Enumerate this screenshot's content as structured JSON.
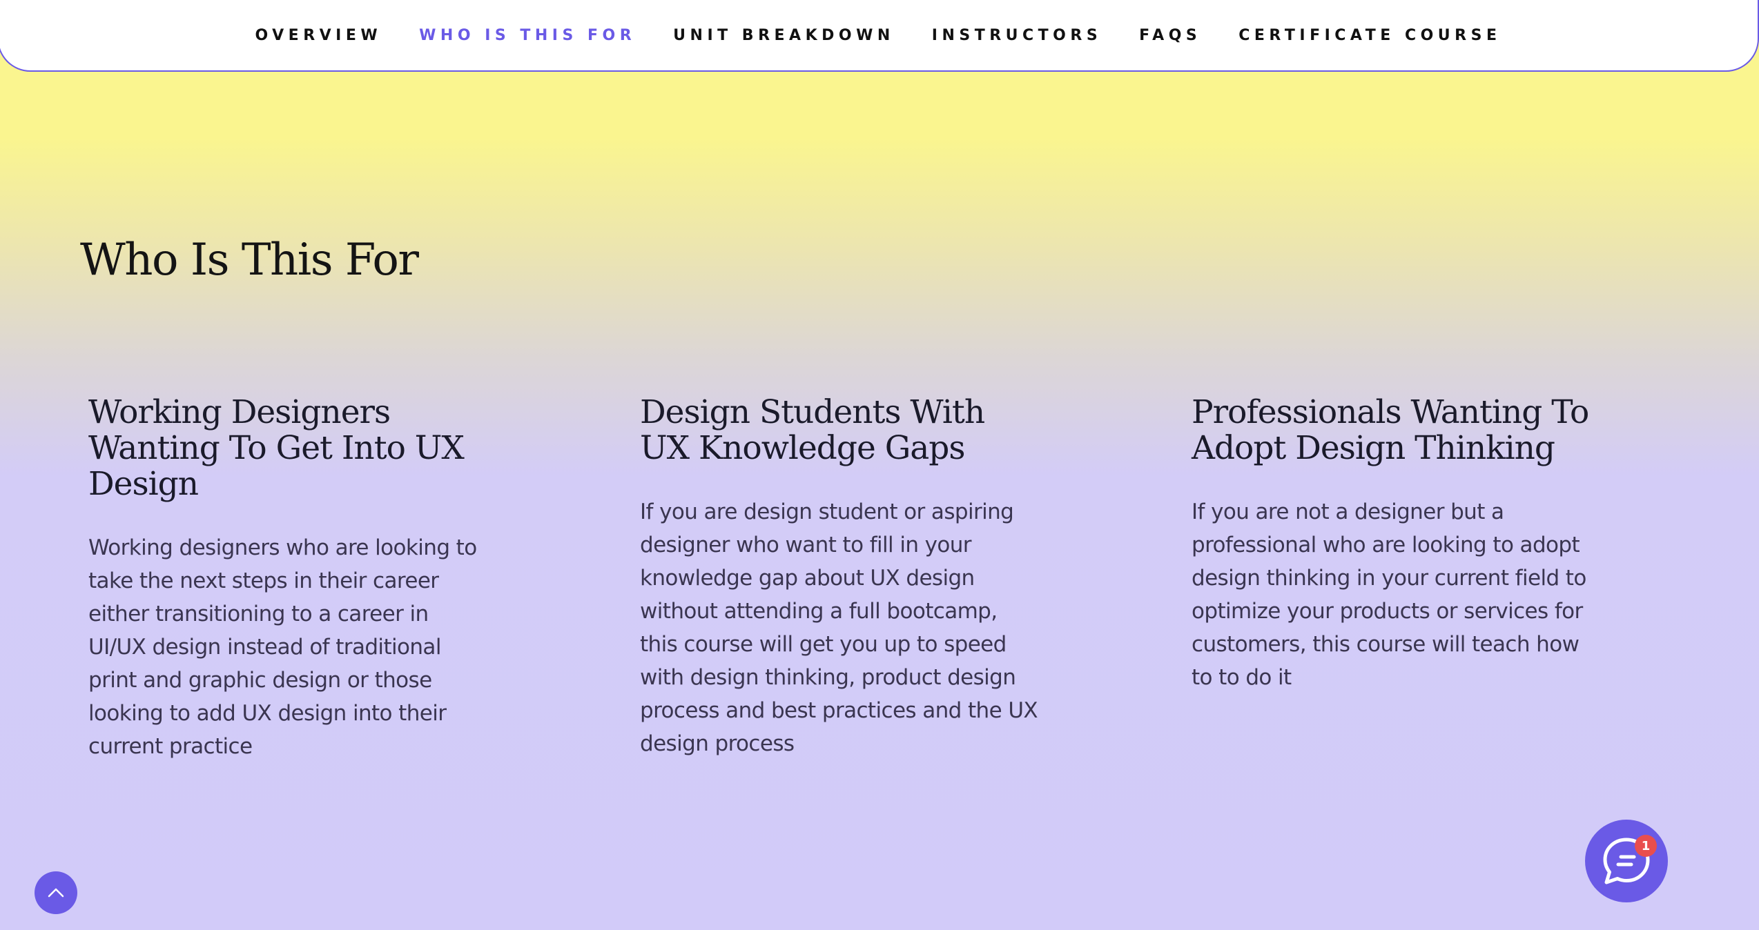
{
  "nav": {
    "items": [
      {
        "label": "OVERVIEW",
        "active": false
      },
      {
        "label": "WHO IS THIS FOR",
        "active": true
      },
      {
        "label": "UNIT BREAKDOWN",
        "active": false
      },
      {
        "label": "INSTRUCTORS",
        "active": false
      },
      {
        "label": "FAQS",
        "active": false
      },
      {
        "label": "CERTIFICATE COURSE",
        "active": false
      }
    ],
    "accent_color": "#6a5ae6"
  },
  "section": {
    "title": "Who Is This For"
  },
  "cards": [
    {
      "title": "Working Designers Wanting To Get Into UX Design",
      "body": "Working designers who are looking to take the next steps in their career either transitioning to a career in UI/UX design instead of traditional print and graphic design or those looking to add UX design into their current practice"
    },
    {
      "title": "Design Students With UX Knowledge Gaps",
      "body": "If you are design student or aspiring designer who want to fill in your knowledge gap about UX design without attending a full bootcamp, this course will get you up to speed with design thinking, product design process and best practices and the UX design process"
    },
    {
      "title": "Professionals Wanting To Adopt Design Thinking",
      "body": "If you are not a designer but a professional who are looking to adopt design thinking in your current field to optimize your products or services for customers, this course will teach how to to do it"
    }
  ],
  "widgets": {
    "scroll_top_icon": "chevron-up-icon",
    "chat_icon": "chat-bubble-icon",
    "chat_badge_count": "1",
    "badge_color": "#e94e4e"
  }
}
